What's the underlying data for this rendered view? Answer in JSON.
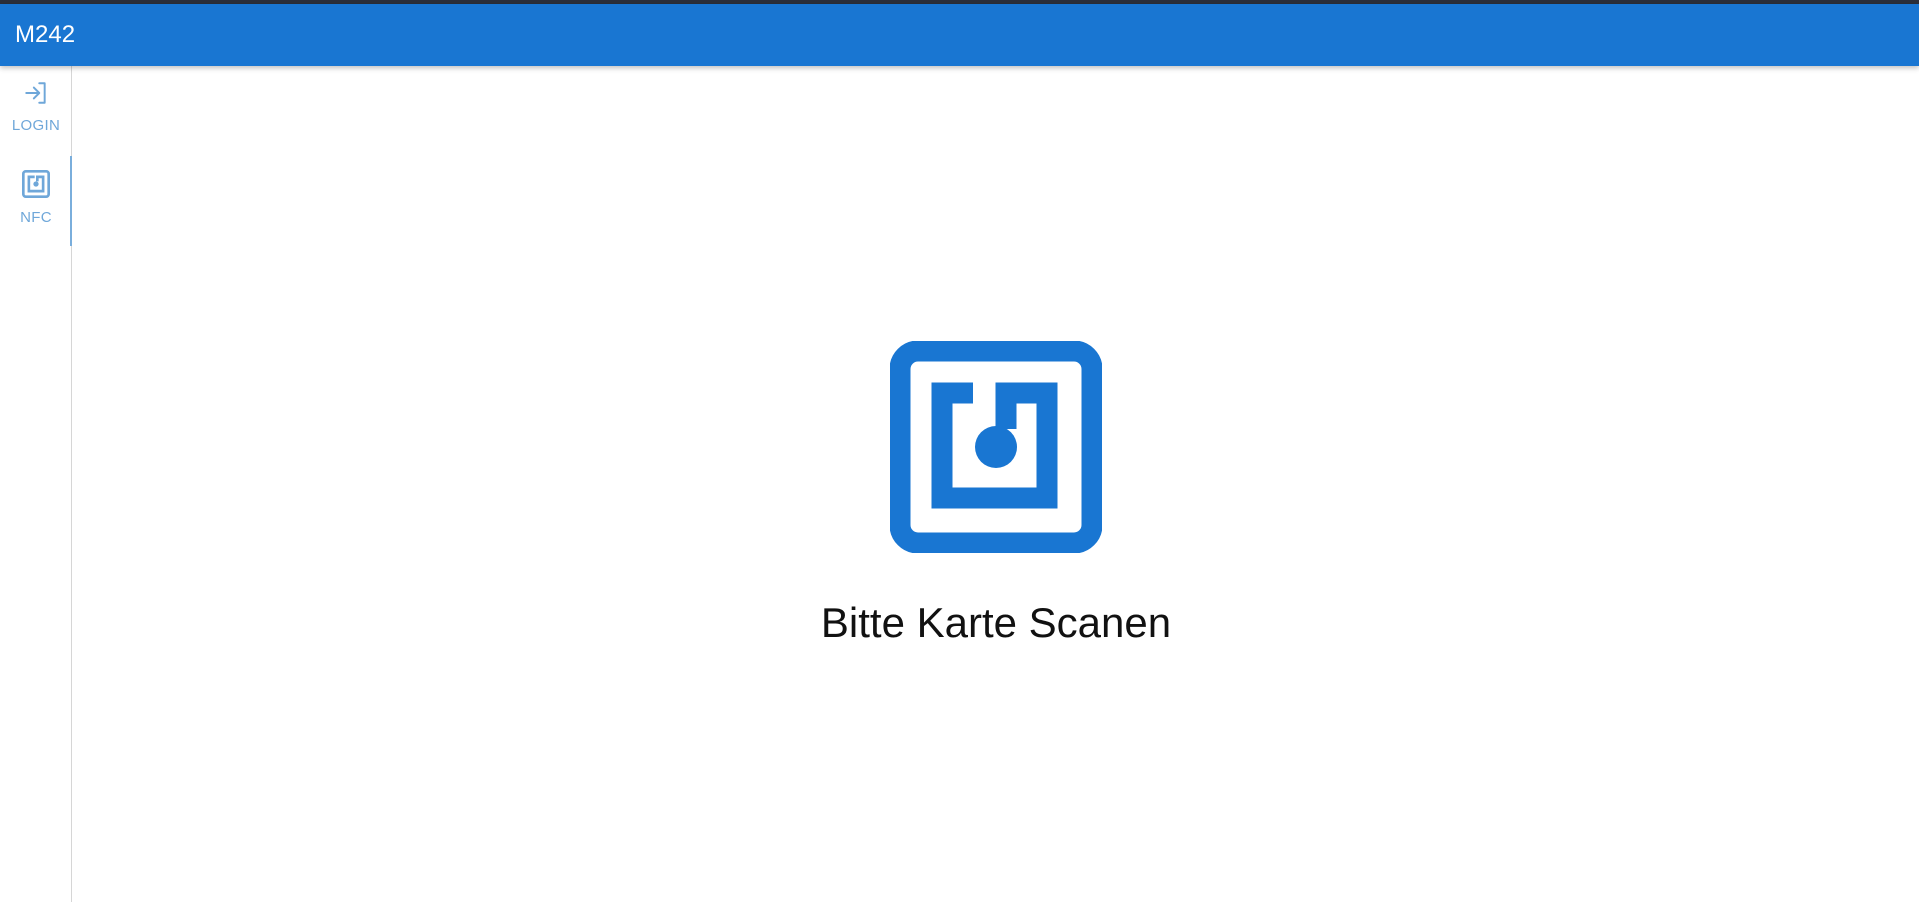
{
  "app": {
    "title": "M242",
    "accent_color": "#1976d2",
    "rail_color": "#6fa7d9"
  },
  "nav_rail": {
    "items": [
      {
        "label": "LOGIN",
        "icon": "login-icon",
        "active": false
      },
      {
        "label": "NFC",
        "icon": "nfc-icon",
        "active": true
      }
    ]
  },
  "main": {
    "icon": "nfc-icon",
    "message": "Bitte Karte Scanen"
  }
}
